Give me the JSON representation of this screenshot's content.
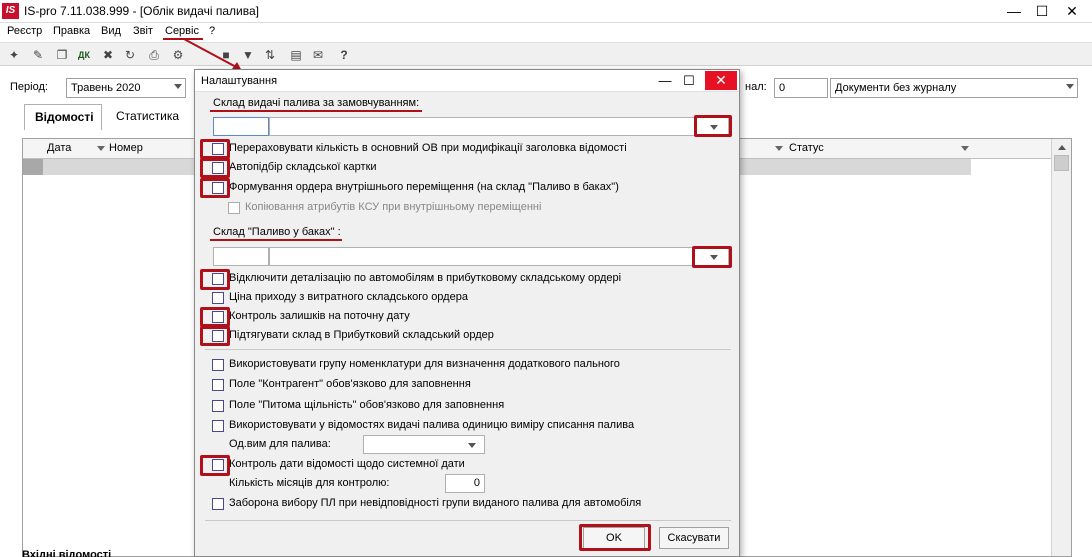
{
  "app": {
    "logo": "IS",
    "title": "IS-pro 7.11.038.999 - [Облік видачі палива]"
  },
  "menu": [
    "Реєстр",
    "Правка",
    "Вид",
    "Звіт",
    "Сервіс",
    "?"
  ],
  "filter": {
    "period_label": "Період:",
    "period_value": "Травень 2020",
    "journal_label_fragment": "нал:",
    "journal_number": "0",
    "journal_value": "Документи без журналу"
  },
  "tabs": [
    "Відомості",
    "Статистика"
  ],
  "grid": {
    "columns": [
      "Дата",
      "Номер",
      "Статус"
    ]
  },
  "bottom_text": "Вхідні відомості",
  "dialog": {
    "title": "Налаштування",
    "default_warehouse_label": "Склад видачі палива за замовчуванням:",
    "tank_warehouse_label": "Склад \"Паливо у баках\" :",
    "checkboxes_group1": [
      {
        "label": "Перераховувати кількість в основний ОВ при модифікації заголовка відомості",
        "checked": false
      },
      {
        "label": "Автопідбір складської картки",
        "checked": false
      },
      {
        "label": "Формування ордера внутрішнього переміщення (на склад \"Паливо в баках\")",
        "checked": false
      },
      {
        "label": "Копіювання атрибутів КСУ при внутрішньому переміщенні",
        "checked": false,
        "disabled": true
      }
    ],
    "checkboxes_group2": [
      {
        "label": "Відключити деталізацію по автомобілям в прибутковому складському ордері",
        "checked": false
      },
      {
        "label": "Ціна приходу з витратного складського ордера",
        "checked": false
      },
      {
        "label": "Контроль залишків на поточну дату",
        "checked": false
      },
      {
        "label": "Підтягувати склад в Прибутковий складський ордер",
        "checked": false
      }
    ],
    "checkboxes_group3": [
      {
        "label": "Використовувати групу номенклатури для визначення додаткового пального",
        "checked": false
      },
      {
        "label": "Поле \"Контрагент\" обов'язково для заповнення",
        "checked": false
      },
      {
        "label": "Поле \"Питома щільність\" обов'язково для заповнення",
        "checked": false
      },
      {
        "label": "Використовувати у відомостях видачі палива одиницю виміру списання палива",
        "checked": false
      }
    ],
    "unit_label": "Од.вим для палива:",
    "unit_value": "",
    "date_control_label": "Контроль дати відомості щодо системної дати",
    "months_label": "Кількість місяців для контролю:",
    "months_value": "0",
    "ban_label": "Заборона вибору ПЛ при невідповідності групи виданого палива для автомобіля",
    "ok_label": "OK",
    "cancel_label": "Скасувати"
  },
  "colors": {
    "accent_red": "#b0101a",
    "close_red": "#e81123",
    "logo_red": "#c8102e"
  }
}
